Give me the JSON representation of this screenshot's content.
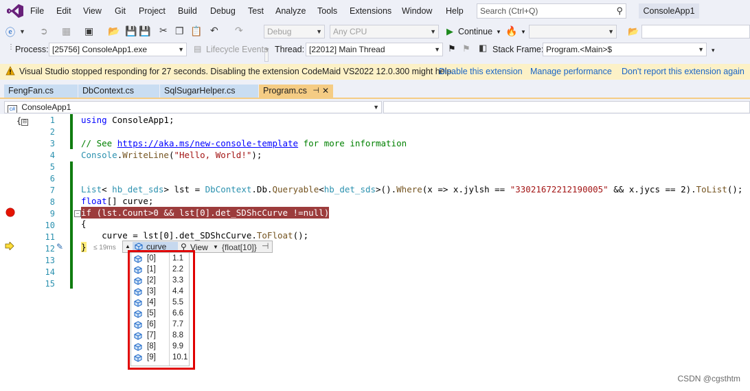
{
  "menu": {
    "items": [
      "File",
      "Edit",
      "View",
      "Git",
      "Project",
      "Build",
      "Debug",
      "Test",
      "Analyze",
      "Tools",
      "Extensions",
      "Window",
      "Help"
    ],
    "search_placeholder": "Search (Ctrl+Q)",
    "solution_title": "ConsoleApp1"
  },
  "toolbar": {
    "config": "Debug",
    "platform": "Any CPU",
    "continue_label": "Continue"
  },
  "debug_location": {
    "process_label": "Process:",
    "process_value": "[25756] ConsoleApp1.exe",
    "lifecycle_label": "Lifecycle Events",
    "thread_label": "Thread:",
    "thread_value": "[22012] Main Thread",
    "stackframe_label": "Stack Frame:",
    "stackframe_value": "Program.<Main>$"
  },
  "infobar": {
    "message": "Visual Studio stopped responding for 27 seconds. Disabling the extension CodeMaid VS2022 12.0.300 might help.",
    "links": [
      "Disable this extension",
      "Manage performance",
      "Don't report this extension again"
    ]
  },
  "tabs": [
    {
      "label": "FengFan.cs",
      "active": false
    },
    {
      "label": "DbContext.cs",
      "active": false
    },
    {
      "label": "SqlSugarHelper.cs",
      "active": false
    },
    {
      "label": "Program.cs",
      "active": true
    }
  ],
  "navbar": {
    "project": "ConsoleApp1"
  },
  "editor": {
    "line_numbers": [
      "1",
      "2",
      "3",
      "4",
      "5",
      "6",
      "7",
      "8",
      "9",
      "10",
      "11",
      "12",
      "13",
      "14",
      "15"
    ],
    "perf_tip": "≤ 19ms"
  },
  "code": {
    "l1": {
      "a": "using",
      "b": " ConsoleApp1;"
    },
    "l3": {
      "a": "// See ",
      "b": "https://aka.ms/new-console-template",
      "c": " for more information"
    },
    "l4": {
      "a": "Console",
      "b": ".",
      "c": "WriteLine",
      "d": "(",
      "e": "\"Hello, World!\"",
      "f": ");"
    },
    "l7": {
      "a": "List",
      "b": "< ",
      "c": "hb_det_sds",
      "d": "> lst = ",
      "e": "DbContext",
      "f": ".Db.",
      "g": "Queryable",
      "h": "<",
      "i": "hb_det_sds",
      "j": ">().",
      "k": "Where",
      "l": "(x => x.jylsh == ",
      "m": "\"33021672212190005\"",
      "n": " && x.jycs == 2).",
      "o": "ToList",
      "p": "();"
    },
    "l8": {
      "a": "float",
      "b": "[] curve;"
    },
    "l9": {
      "a": "if (lst.Count>0 && lst[0].det_SDShcCurve !=null)"
    },
    "l10": {
      "a": "{"
    },
    "l11": {
      "a": "    curve = lst[0].det_SDShcCurve.",
      "b": "ToFloat",
      "c": "();"
    },
    "l12": {
      "a": "}"
    }
  },
  "datatip": {
    "variable": "curve",
    "view_label": "View",
    "type_label": "{float[10]}",
    "items": [
      {
        "index": "[0]",
        "value": "1.1"
      },
      {
        "index": "[1]",
        "value": "2.2"
      },
      {
        "index": "[2]",
        "value": "3.3"
      },
      {
        "index": "[3]",
        "value": "4.4"
      },
      {
        "index": "[4]",
        "value": "5.5"
      },
      {
        "index": "[5]",
        "value": "6.6"
      },
      {
        "index": "[6]",
        "value": "7.7"
      },
      {
        "index": "[7]",
        "value": "8.8"
      },
      {
        "index": "[8]",
        "value": "9.9"
      },
      {
        "index": "[9]",
        "value": "10.1"
      }
    ]
  },
  "watermark": "CSDN @cgsthtm",
  "colors": {
    "accent": "#68217a",
    "breakpoint": "#e51400",
    "highlight_box": "#e00000",
    "infobar_bg": "#fcf1c7",
    "active_tab": "#f5cc84"
  }
}
